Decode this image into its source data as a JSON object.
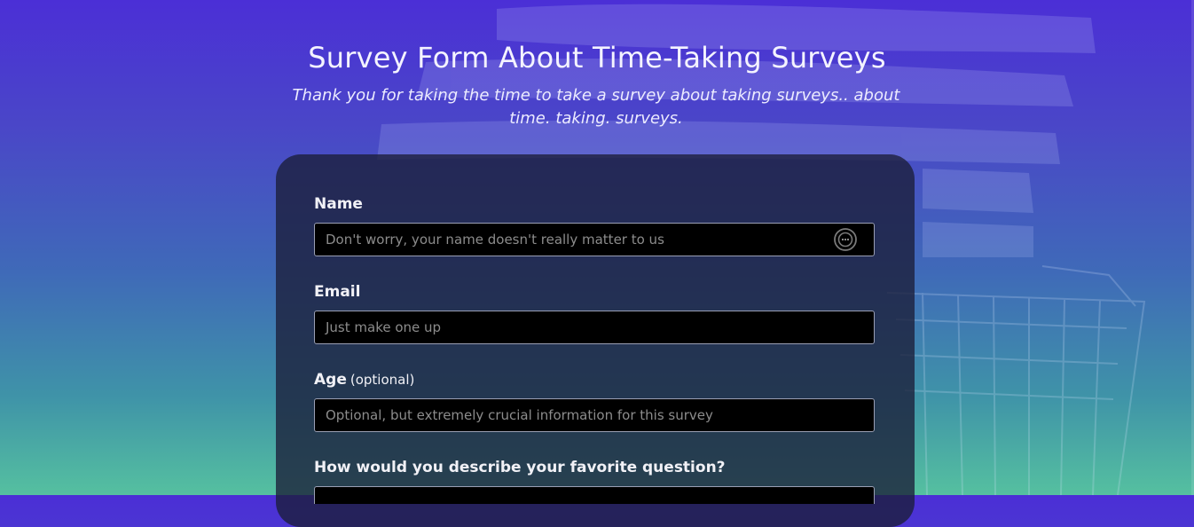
{
  "header": {
    "title": "Survey Form About Time-Taking Surveys",
    "subtitle": "Thank you for taking the time to take a survey about taking surveys.. about time. taking. surveys."
  },
  "form": {
    "name": {
      "label": "Name",
      "placeholder": "Don't worry, your name doesn't really matter to us"
    },
    "email": {
      "label": "Email",
      "placeholder": "Just make one up"
    },
    "age": {
      "label": "Age",
      "optional_tag": "(optional)",
      "placeholder": "Optional, but extremely crucial information for this survey"
    },
    "favorite_question": {
      "label": "How would you describe your favorite question?"
    }
  },
  "icons": {
    "name_field_icon": "password-manager-icon"
  },
  "colors": {
    "card_bg": "#1b1e38",
    "input_bg": "#000000",
    "input_border": "#9a9fb4",
    "gradient_top": "#4b2fd6",
    "gradient_bottom": "#55c0a0"
  }
}
